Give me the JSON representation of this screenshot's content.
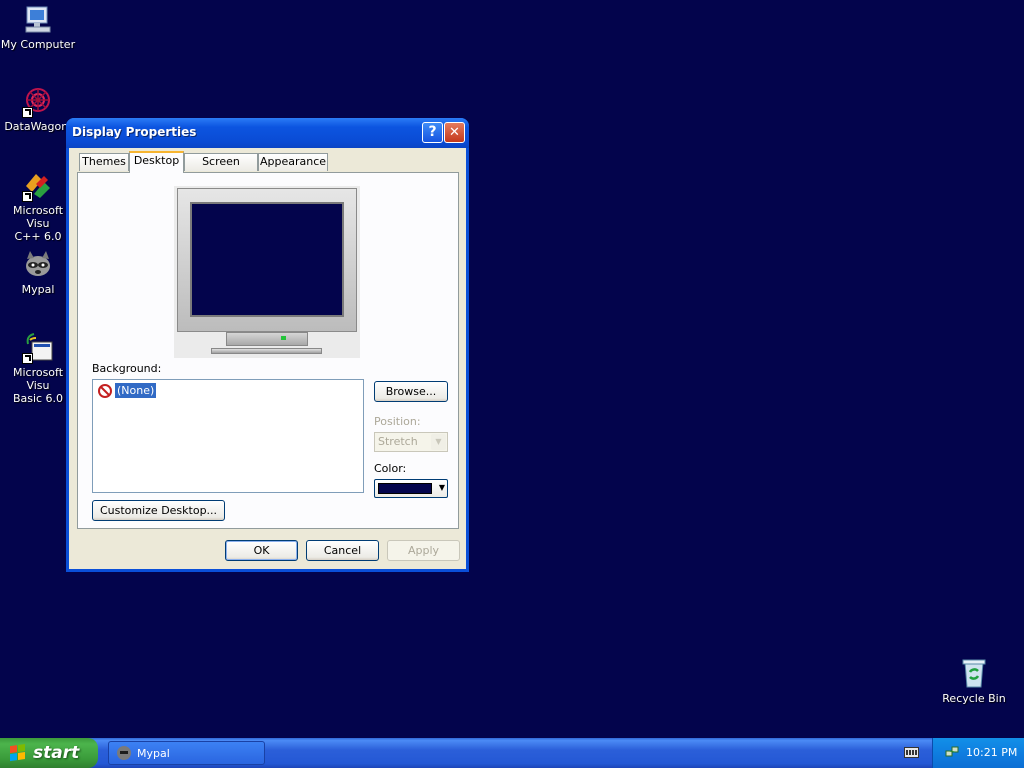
{
  "desktop": {
    "background_color": "#03044c",
    "icons": [
      {
        "label": "My Computer",
        "icon": "computer-icon"
      },
      {
        "label": "DataWagon.",
        "icon": "datawagon-icon"
      },
      {
        "label": "Microsoft Visu\nC++ 6.0",
        "icon": "visual-cpp-icon"
      },
      {
        "label": "Mypal",
        "icon": "mypal-raccoon-icon"
      },
      {
        "label": "Microsoft Visu\nBasic 6.0",
        "icon": "visual-basic-icon"
      },
      {
        "label": "Recycle Bin",
        "icon": "recycle-bin-icon"
      }
    ]
  },
  "dialog": {
    "title": "Display Properties",
    "tabs": [
      "Themes",
      "Desktop",
      "Screen Saver",
      "Appearance"
    ],
    "active_tab": "Desktop",
    "background_label": "Background:",
    "background_items": [
      "(None)"
    ],
    "browse_label": "Browse...",
    "position_label": "Position:",
    "position_value": "Stretch",
    "color_label": "Color:",
    "color_value": "#03044c",
    "customize_label": "Customize Desktop...",
    "ok_label": "OK",
    "cancel_label": "Cancel",
    "apply_label": "Apply"
  },
  "taskbar": {
    "start_label": "start",
    "task_label": "Mypal",
    "clock": "10:21 PM"
  }
}
